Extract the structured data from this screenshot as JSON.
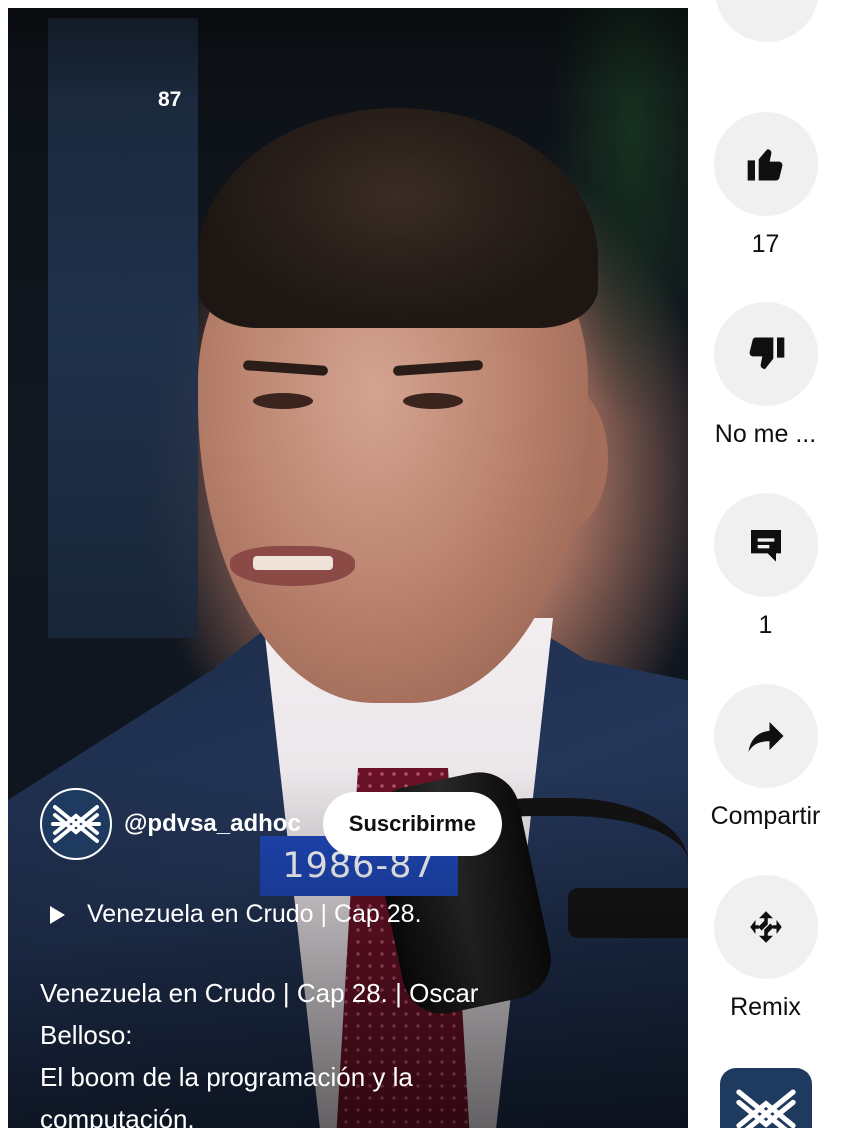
{
  "video": {
    "view_count": "87",
    "date_banner": "1986-87"
  },
  "channel": {
    "handle": "@pdvsa_adhoc",
    "subscribe_label": "Suscribirme",
    "avatar_icon": "pdvsa-logo-icon"
  },
  "playlist": {
    "icon": "play-icon",
    "label": "Venezuela en Crudo | Cap 28."
  },
  "description": {
    "line1": "Venezuela en Crudo | Cap 28. | Oscar Belloso:",
    "line2": "El boom de la programación y la",
    "line3": "computación."
  },
  "actions": {
    "like": {
      "icon": "thumbs-up-icon",
      "label": "17"
    },
    "dislike": {
      "icon": "thumbs-down-icon",
      "label": "No me ..."
    },
    "comments": {
      "icon": "comment-icon",
      "label": "1"
    },
    "share": {
      "icon": "share-arrow-icon",
      "label": "Compartir"
    },
    "remix": {
      "icon": "remix-icon",
      "label": "Remix"
    }
  },
  "colors": {
    "accent_banner": "#1f48b8",
    "action_bg": "#f0f0f0",
    "avatar_bg": "#1f3a5f"
  }
}
